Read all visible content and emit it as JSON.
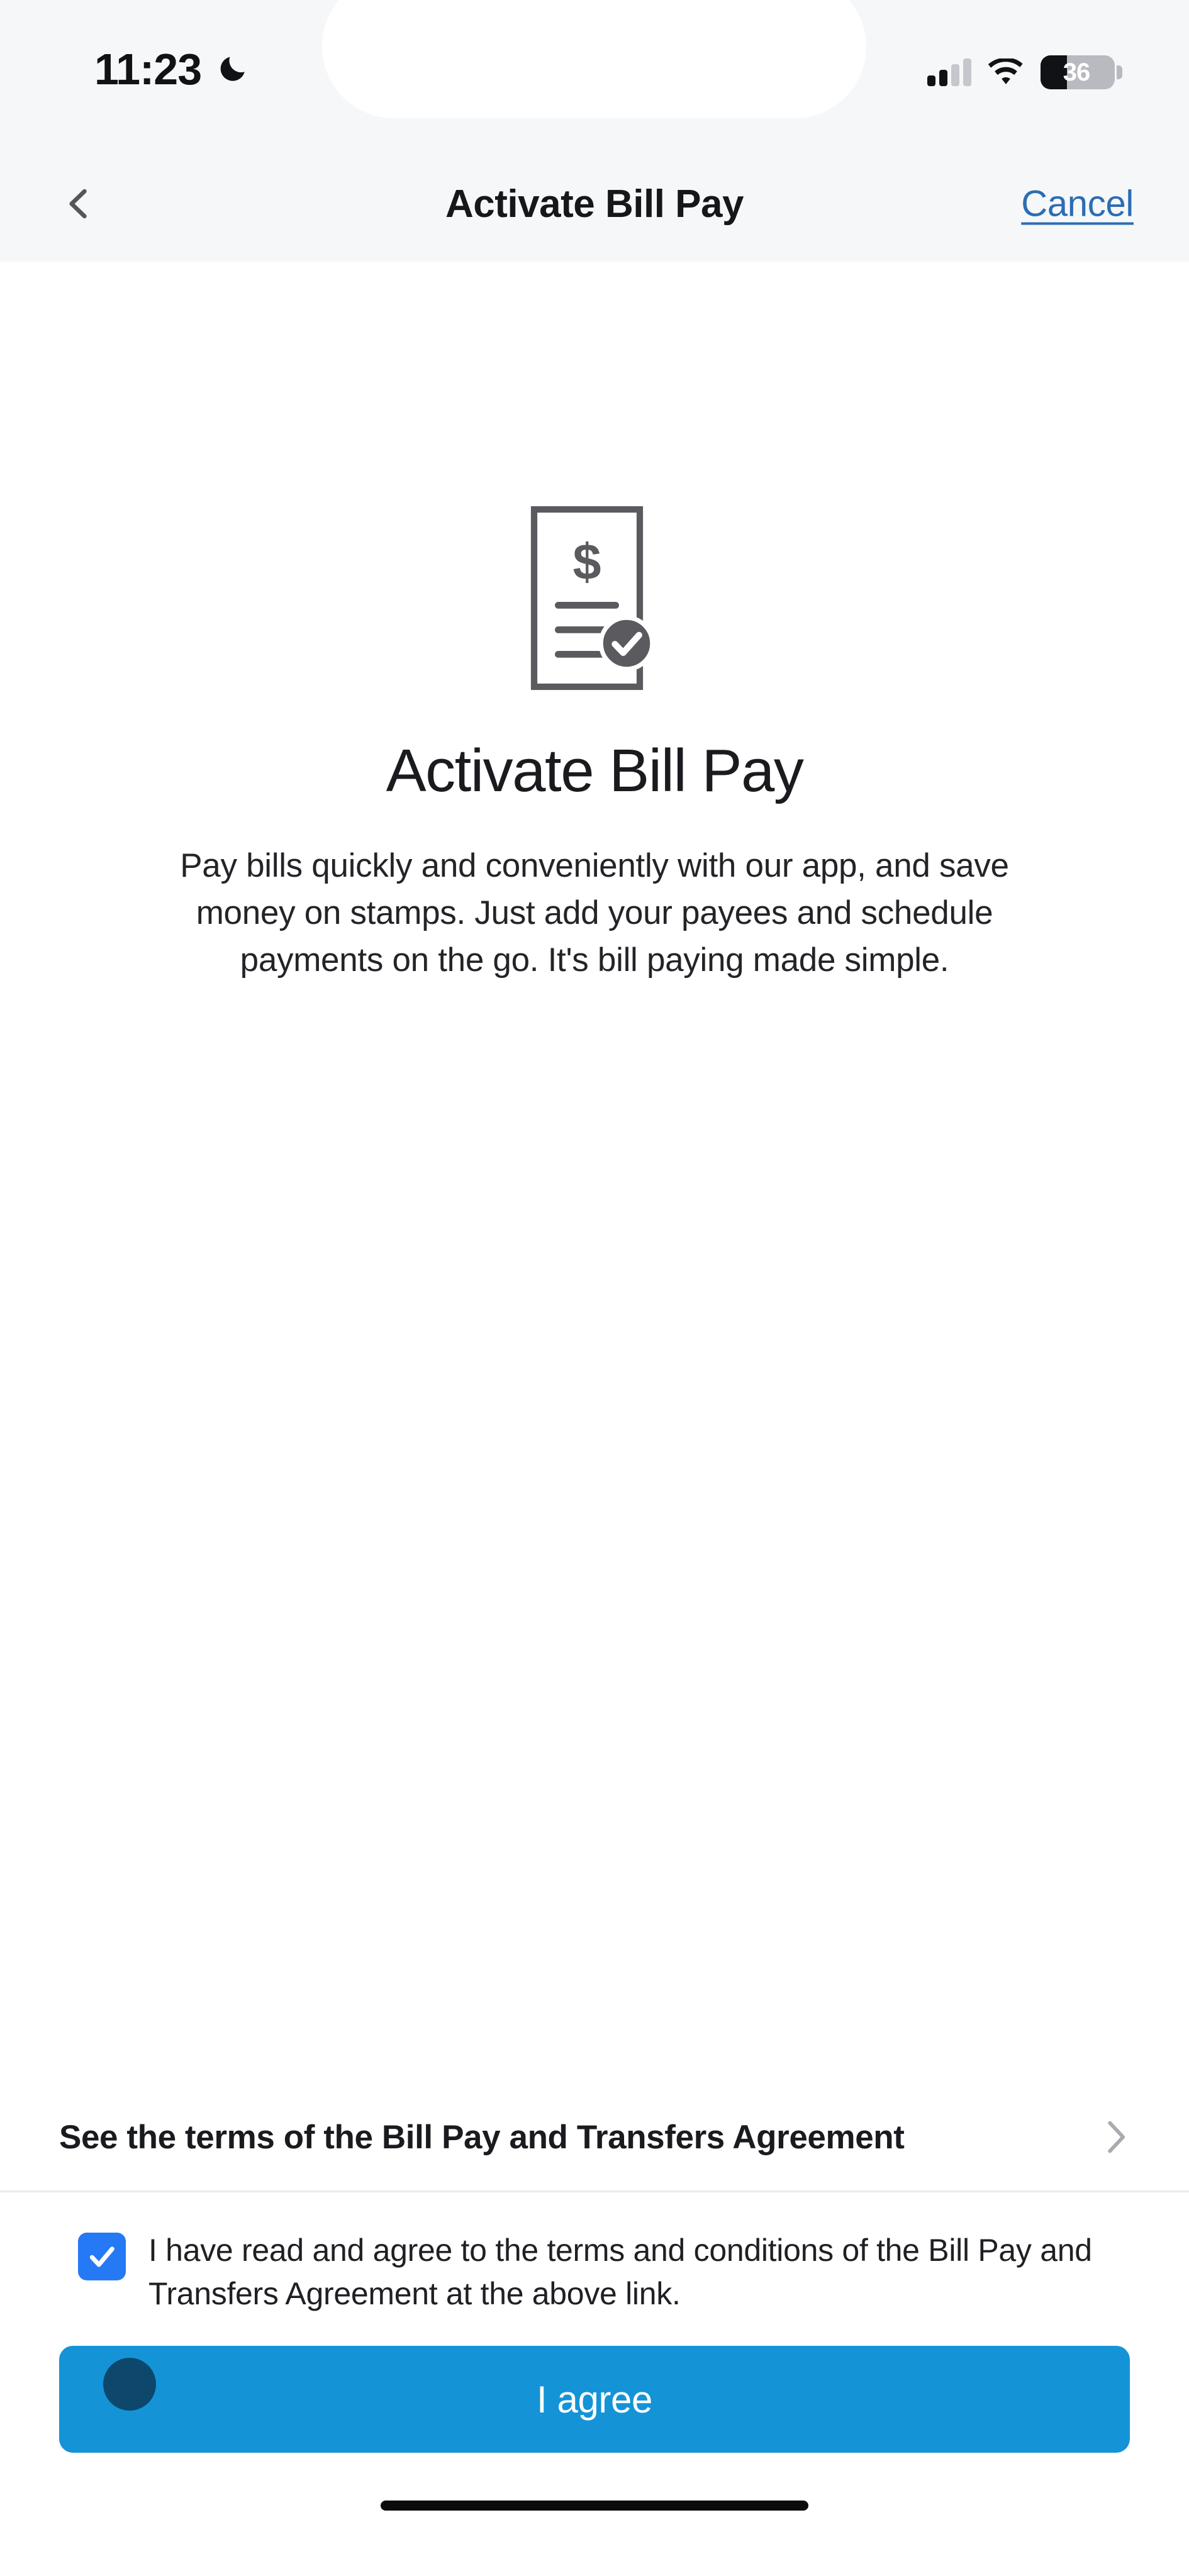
{
  "status_bar": {
    "time": "11:23",
    "dnd_icon": "moon-icon",
    "signal_icon": "cellular-signal-icon",
    "signal_bars_filled": 2,
    "signal_bars_total": 4,
    "wifi_icon": "wifi-icon",
    "battery_percent": "36",
    "battery_level": 36,
    "background_color": "#f6f7f9"
  },
  "nav_bar": {
    "back_icon": "chevron-left-icon",
    "title": "Activate Bill Pay",
    "cancel_label": "Cancel",
    "cancel_color": "#2b6db3",
    "background_color": "#f6f7f9"
  },
  "hero": {
    "icon": "bill-document-check-icon",
    "icon_color": "#5a5a5f",
    "title": "Activate Bill Pay",
    "body": "Pay bills quickly and conveniently with our app, and save money on stamps. Just add your payees and schedule payments on the go. It's bill paying made simple."
  },
  "terms_row": {
    "label": "See the terms of the Bill Pay and Transfers Agreement",
    "chevron_icon": "chevron-right-icon"
  },
  "consent": {
    "checked": true,
    "checkbox_icon": "checkbox-checked-icon",
    "checkbox_color": "#2579f5",
    "text": "I have read and agree to the terms and conditions of the Bill Pay and Transfers Agreement at the above link."
  },
  "primary_action": {
    "label": "I agree",
    "background_color": "#1494d7",
    "text_color": "#ffffff",
    "touch_indicator": "touch-point-indicator"
  },
  "home_indicator": {
    "icon": "home-indicator-bar"
  }
}
